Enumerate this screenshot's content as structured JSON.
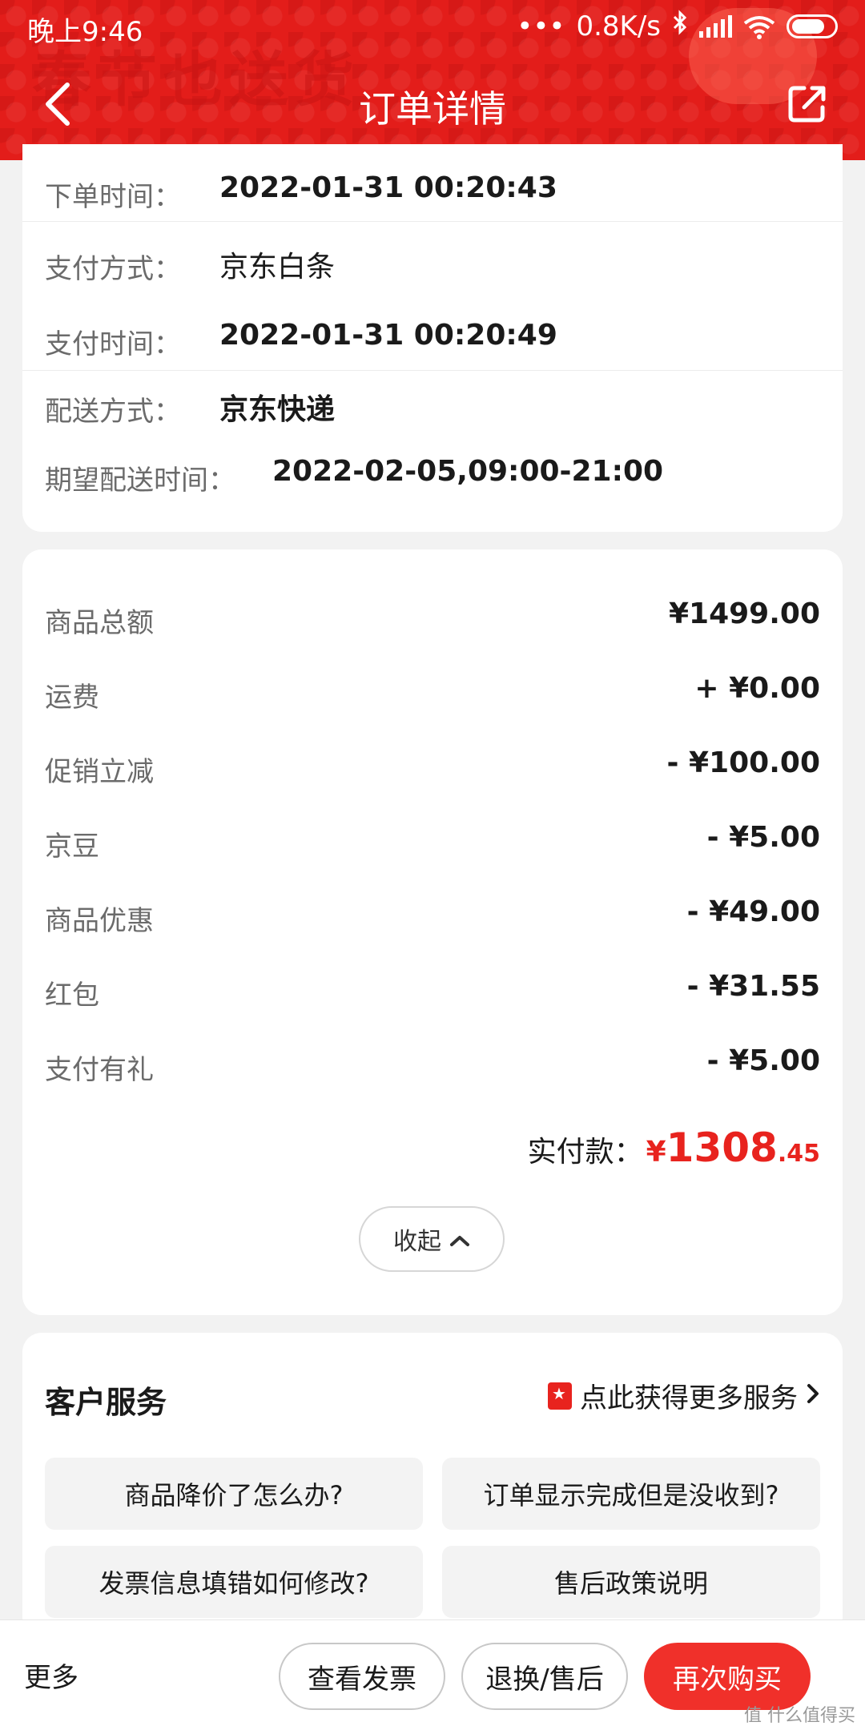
{
  "status_bar": {
    "time": "晚上9:46",
    "network_speed": "0.8K/s",
    "icons": [
      "dots-icon",
      "bluetooth-icon",
      "signal-icon",
      "wifi-icon",
      "battery-icon"
    ]
  },
  "header": {
    "title": "订单详情",
    "banner_text": "春节也送货",
    "bg_color": "#e31d1a"
  },
  "order_info": {
    "order_time": {
      "label": "下单时间：",
      "value": "2022-01-31 00:20:43"
    },
    "payment_method": {
      "label": "支付方式：",
      "value": "京东白条"
    },
    "payment_time": {
      "label": "支付时间：",
      "value": "2022-01-31 00:20:49"
    },
    "delivery_method": {
      "label": "配送方式：",
      "value": "京东快递"
    },
    "expected_delivery": {
      "label": "期望配送时间：",
      "value": "2022-02-05,09:00-21:00"
    }
  },
  "amounts": {
    "rows": [
      {
        "label": "商品总额",
        "value": "¥1499.00"
      },
      {
        "label": "运费",
        "value": "+ ¥0.00"
      },
      {
        "label": "促销立减",
        "value": "- ¥100.00"
      },
      {
        "label": "京豆",
        "value": "- ¥5.00"
      },
      {
        "label": "商品优惠",
        "value": "- ¥49.00"
      },
      {
        "label": "红包",
        "value": "- ¥31.55"
      },
      {
        "label": "支付有礼",
        "value": "- ¥5.00"
      }
    ],
    "paid_label": "实付款：",
    "paid_currency": "¥",
    "paid_integer": "1308",
    "paid_decimal": ".45",
    "collapse_label": "收起",
    "accent_color": "#e8231e"
  },
  "customer_service": {
    "title": "客户服务",
    "more_label": "点此获得更多服务",
    "buttons": [
      "商品降价了怎么办?",
      "订单显示完成但是没收到?",
      "发票信息填错如何修改?",
      "售后政策说明"
    ]
  },
  "bottom_bar": {
    "more_label": "更多",
    "invoice_label": "查看发票",
    "return_label": "退换/售后",
    "rebuy_label": "再次购买"
  },
  "watermark": "值 什么值得买"
}
